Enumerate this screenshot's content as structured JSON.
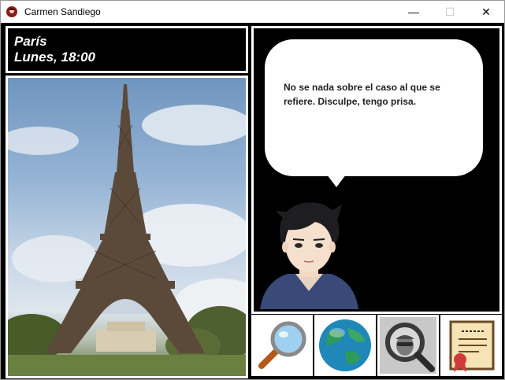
{
  "window": {
    "title": "Carmen Sandiego",
    "minimize_label": "—",
    "maximize_label": "☐",
    "close_label": "✕"
  },
  "location": {
    "city": "París",
    "datetime": "Lunes, 18:00"
  },
  "dialog": {
    "message": "No se nada sobre el caso al que se refiere. Disculpe, tengo prisa."
  },
  "photo": {
    "subject": "eiffel-tower-icon"
  },
  "actions": [
    {
      "name": "investigate",
      "icon": "magnifier-icon"
    },
    {
      "name": "travel",
      "icon": "globe-icon"
    },
    {
      "name": "suspects",
      "icon": "suspect-search-icon"
    },
    {
      "name": "warrant",
      "icon": "certificate-icon"
    }
  ],
  "colors": {
    "panel_border": "#ffffff",
    "background": "#000000",
    "text": "#ffffff"
  }
}
